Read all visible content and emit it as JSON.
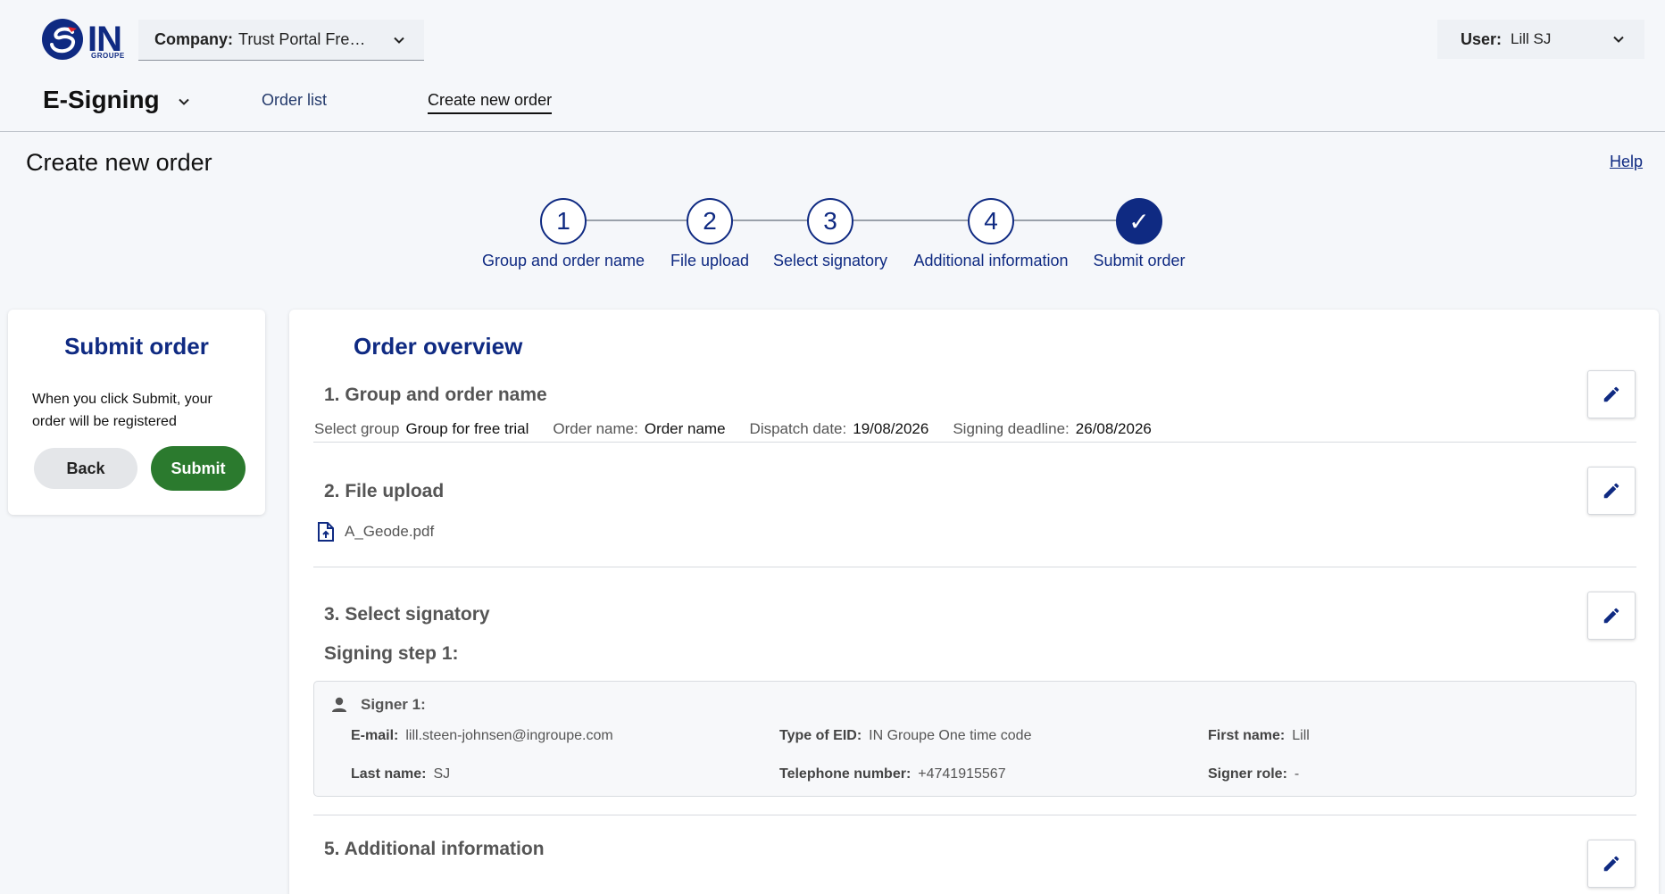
{
  "header": {
    "logo": {
      "text": "IN",
      "subtext": "GROUPE"
    },
    "company": {
      "label": "Company:",
      "value": "Trust Portal Free trial"
    },
    "user": {
      "label": "User:",
      "value": "Lill SJ"
    },
    "app_title": "E-Signing",
    "nav": {
      "order_list": "Order list",
      "create_new_order": "Create new order"
    }
  },
  "page": {
    "title": "Create new order",
    "help": "Help"
  },
  "stepper": {
    "steps": [
      {
        "number": "1",
        "label": "Group and order name",
        "done": false
      },
      {
        "number": "2",
        "label": "File upload",
        "done": false
      },
      {
        "number": "3",
        "label": "Select signatory",
        "done": false
      },
      {
        "number": "4",
        "label": "Additional information",
        "done": false
      },
      {
        "number": "✓",
        "label": "Submit order",
        "done": true
      }
    ],
    "active_color": "#0f2a82"
  },
  "side": {
    "title": "Submit order",
    "description": "When you click Submit, your order will be registered",
    "back_label": "Back",
    "submit_label": "Submit",
    "submit_color": "#2b7a2e"
  },
  "overview": {
    "title": "Order overview",
    "group_section": {
      "title": "1. Group and order name",
      "select_group_label": "Select group",
      "select_group_value": "Group for free trial",
      "order_name_label": "Order name:",
      "order_name_value": "Order name",
      "dispatch_date_label": "Dispatch date:",
      "dispatch_date_value": "19/08/2026",
      "signing_deadline_label": "Signing deadline:",
      "signing_deadline_value": "26/08/2026"
    },
    "file_section": {
      "title": "2. File upload",
      "file_name": "A_Geode.pdf"
    },
    "signatory_section": {
      "title": "3. Select signatory",
      "step_title": "Signing step 1:",
      "signer": {
        "heading": "Signer 1:",
        "email_label": "E-mail:",
        "email_value": "lill.steen-johnsen@ingroupe.com",
        "eid_label": "Type of EID:",
        "eid_value": "IN Groupe One time code",
        "first_name_label": "First name:",
        "first_name_value": "Lill",
        "last_name_label": "Last name:",
        "last_name_value": "SJ",
        "phone_label": "Telephone number:",
        "phone_value": "+4741915567",
        "role_label": "Signer role:",
        "role_value": "-"
      }
    },
    "additional_section": {
      "title": "5. Additional information"
    }
  }
}
